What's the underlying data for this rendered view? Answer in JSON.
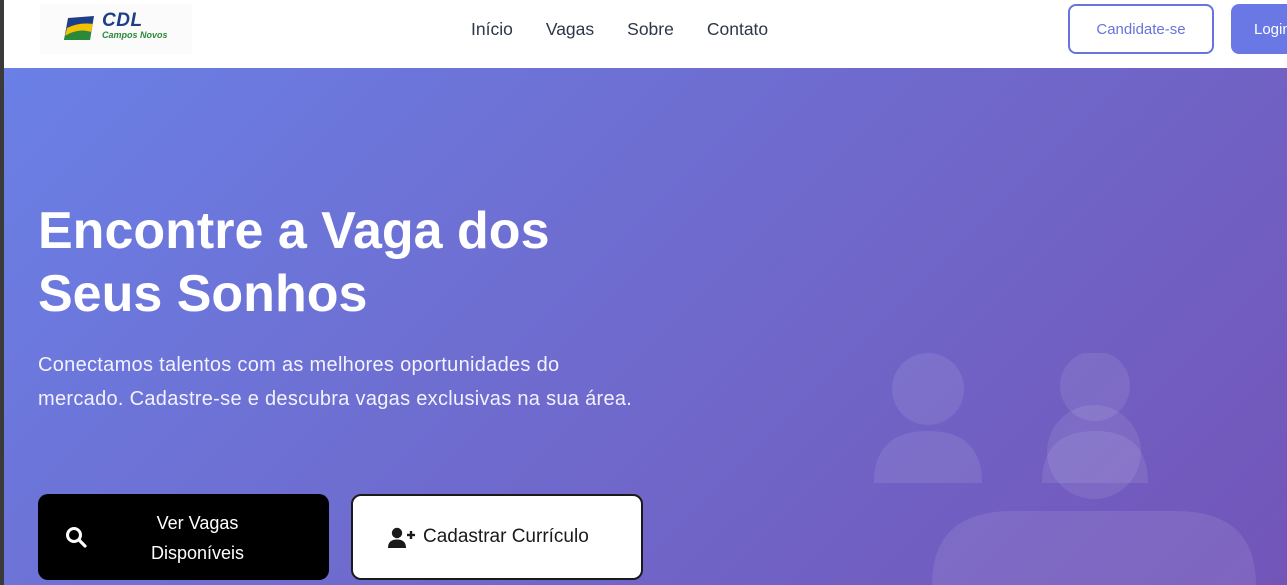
{
  "brand": {
    "name": "CDL",
    "city": "Campos Novos",
    "colors": {
      "blue": "#1f3e8a",
      "green": "#2a8a3a"
    }
  },
  "nav": {
    "items": [
      {
        "label": "Início"
      },
      {
        "label": "Vagas"
      },
      {
        "label": "Sobre"
      },
      {
        "label": "Contato"
      }
    ]
  },
  "header_actions": {
    "candidate_label": "Candidate-se",
    "login_label": "Login"
  },
  "hero": {
    "title_line1": "Encontre a Vaga dos",
    "title_line2": "Seus Sonhos",
    "subtitle": "Conectamos talentos com as melhores oportunidades do mercado. Cadastre-se e descubra vagas exclusivas na sua área.",
    "primary_button_line1": "Ver Vagas",
    "primary_button_line2": "Disponíveis",
    "primary_button_icon": "search-icon",
    "secondary_button": "Cadastrar Currículo",
    "secondary_button_icon": "user-plus-icon",
    "illustration_icon": "users-group-icon",
    "gradient": {
      "start": "#6a80e6",
      "end": "#7355b8"
    }
  },
  "colors": {
    "accent": "#6674db",
    "nav_text": "#2d3748"
  }
}
